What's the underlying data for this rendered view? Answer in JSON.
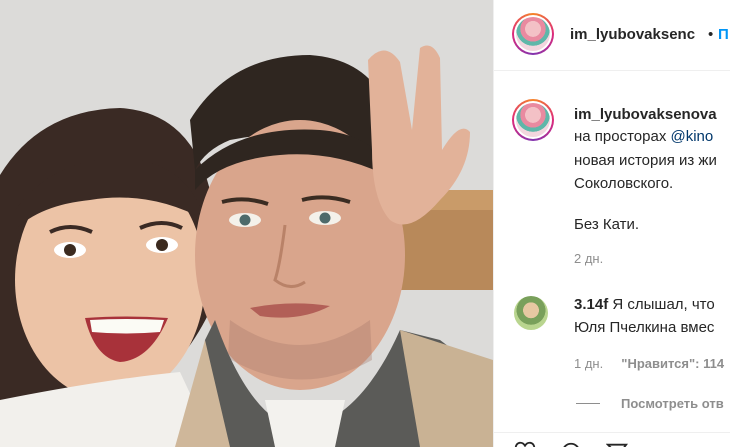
{
  "post": {
    "username": "im_lyubovaksenc",
    "separator": "•",
    "follow_label": "П",
    "photo_alt": "selfie",
    "caption": {
      "username": "im_lyubovaksenova",
      "lines": [
        {
          "text": "на просторах ",
          "mention": "@kino"
        },
        {
          "text": "новая история из жи",
          "mention": ""
        },
        {
          "text": "Соколовского.",
          "mention": ""
        },
        {
          "text": "",
          "mention": ""
        },
        {
          "text": "Без Кати.",
          "mention": ""
        }
      ],
      "time": "2 дн."
    },
    "comments": [
      {
        "username": "3.14f",
        "text_line1": "Я слышал, что",
        "text_line2": "Юля Пчелкина вмес",
        "time": "1 дн.",
        "likes": "\"Нравится\": 114"
      }
    ],
    "view_replies": "Посмотреть отв"
  },
  "icons": [
    "heart-icon",
    "comment-icon",
    "share-icon"
  ],
  "colors": {
    "accent": "#0095f6",
    "mention": "#00376b",
    "muted": "#8e8e8e"
  }
}
